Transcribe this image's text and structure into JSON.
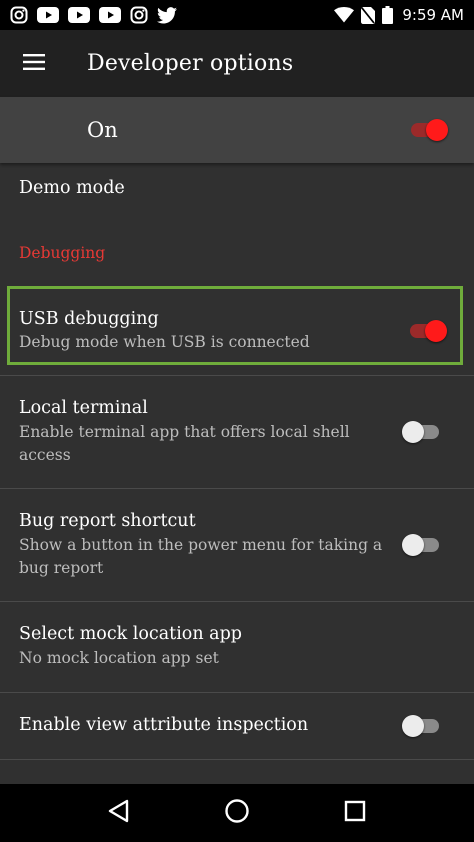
{
  "status_bar": {
    "notification_icons": [
      "instagram-icon",
      "youtube-icon",
      "youtube-icon",
      "youtube-icon",
      "instagram-icon",
      "twitter-icon"
    ],
    "system_icons": [
      "wifi-icon",
      "no-sim-icon",
      "battery-icon"
    ],
    "time": "9:59 AM"
  },
  "toolbar": {
    "title": "Developer options"
  },
  "master_switch": {
    "label": "On",
    "checked": true
  },
  "items": {
    "demo_mode": {
      "title": "Demo mode"
    },
    "category_debugging": "Debugging",
    "usb_debugging": {
      "title": "USB debugging",
      "summary": "Debug mode when USB is connected",
      "checked": true
    },
    "local_terminal": {
      "title": "Local terminal",
      "summary_line1": "Enable terminal app that offers local shell",
      "summary_line2": "access",
      "checked": false
    },
    "bug_report": {
      "title": "Bug report shortcut",
      "summary_line1": "Show a button in the power menu for taking a",
      "summary_line2": "bug report",
      "checked": false
    },
    "mock_location": {
      "title": "Select mock location app",
      "summary": "No mock location app set"
    },
    "view_attribute": {
      "title": "Enable view attribute inspection",
      "checked": false
    }
  },
  "colors": {
    "accent": "#ff1a1a",
    "category_text": "#e53935",
    "highlight_border": "#6fac3b",
    "toolbar": "#212121",
    "background": "#303030"
  },
  "nav_bar": {
    "buttons": [
      "back-icon",
      "home-icon",
      "recents-icon"
    ]
  }
}
